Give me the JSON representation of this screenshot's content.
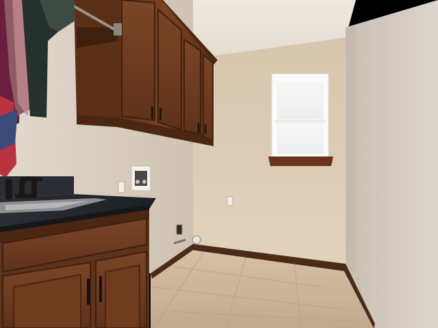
{
  "scene": {
    "kind": "photo",
    "subject": "laundry-room",
    "elements": [
      "upper-cabinets",
      "hanging-rod",
      "hanging-clothes",
      "vanity-cabinet",
      "granite-countertop",
      "utility-sink",
      "faucet",
      "washer-box",
      "electrical-outlet",
      "light-switch",
      "dryer-outlet",
      "gas-valve",
      "window",
      "window-sill",
      "baseboard",
      "tile-floor"
    ]
  },
  "colors": {
    "wall_left": "#d6ccbf",
    "wall_back": "#dccdb8",
    "wall_right": "#d3cac2",
    "ceiling": "#ebe4da",
    "cabinet_wood": "#6b3a1f",
    "cabinet_dark": "#4a2613",
    "countertop": "#22252b",
    "floor_tile": "#c9b197",
    "window_glass": "#f4f4f2",
    "window_frame": "#fbfbfa",
    "baseboard": "#4b2a18"
  }
}
